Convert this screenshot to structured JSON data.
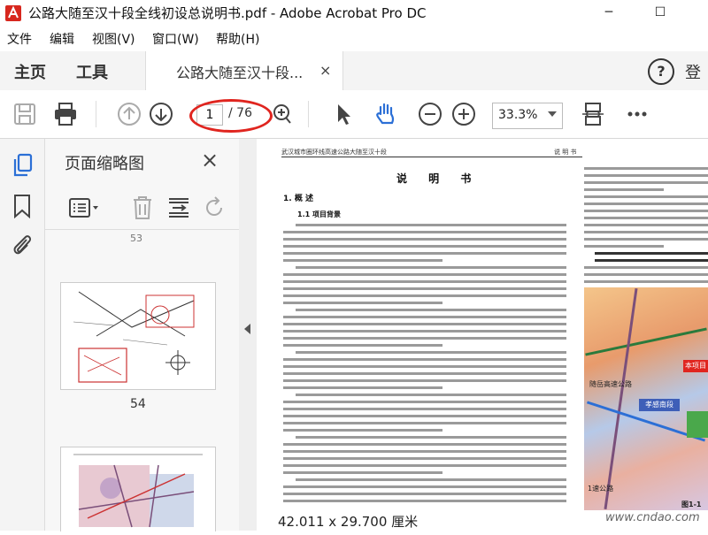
{
  "window": {
    "title": "公路大随至汉十段全线初设总说明书.pdf - Adobe Acrobat Pro DC",
    "minimize": "─",
    "maximize": "☐"
  },
  "menu": [
    "文件",
    "编辑",
    "视图(V)",
    "窗口(W)",
    "帮助(H)"
  ],
  "tabs": {
    "home": "主页",
    "tools": "工具",
    "document": "公路大随至汉十段...",
    "close": "×",
    "help": "?",
    "signin": "登"
  },
  "toolbar": {
    "current_page": "1",
    "total_pages": "/ 76",
    "zoom": "33.3%"
  },
  "thumbnails": {
    "title": "页面缩略图",
    "close": "×",
    "prev_label": "53",
    "labels": [
      "54"
    ]
  },
  "document": {
    "header_left": "武汉城市圈环线高速公路大随至汉十段",
    "header_right": "说 明 书",
    "title": "说 明 书",
    "section": "1. 概 述",
    "subsection": "1.1 项目背景",
    "map_labels": {
      "red": "本项目",
      "blue": "孝感南段",
      "road": "随岳高速公路",
      "bottom": "1速公路",
      "figure": "图1-1"
    }
  },
  "status": {
    "page_size": "42.011 x 29.700 厘米",
    "watermark": "www.cndao.com"
  },
  "colors": {
    "annotation_circle": "#e0251f",
    "map_red": "#e0251f",
    "map_blue": "#3e5fb8",
    "map_green": "#4aa84b"
  }
}
